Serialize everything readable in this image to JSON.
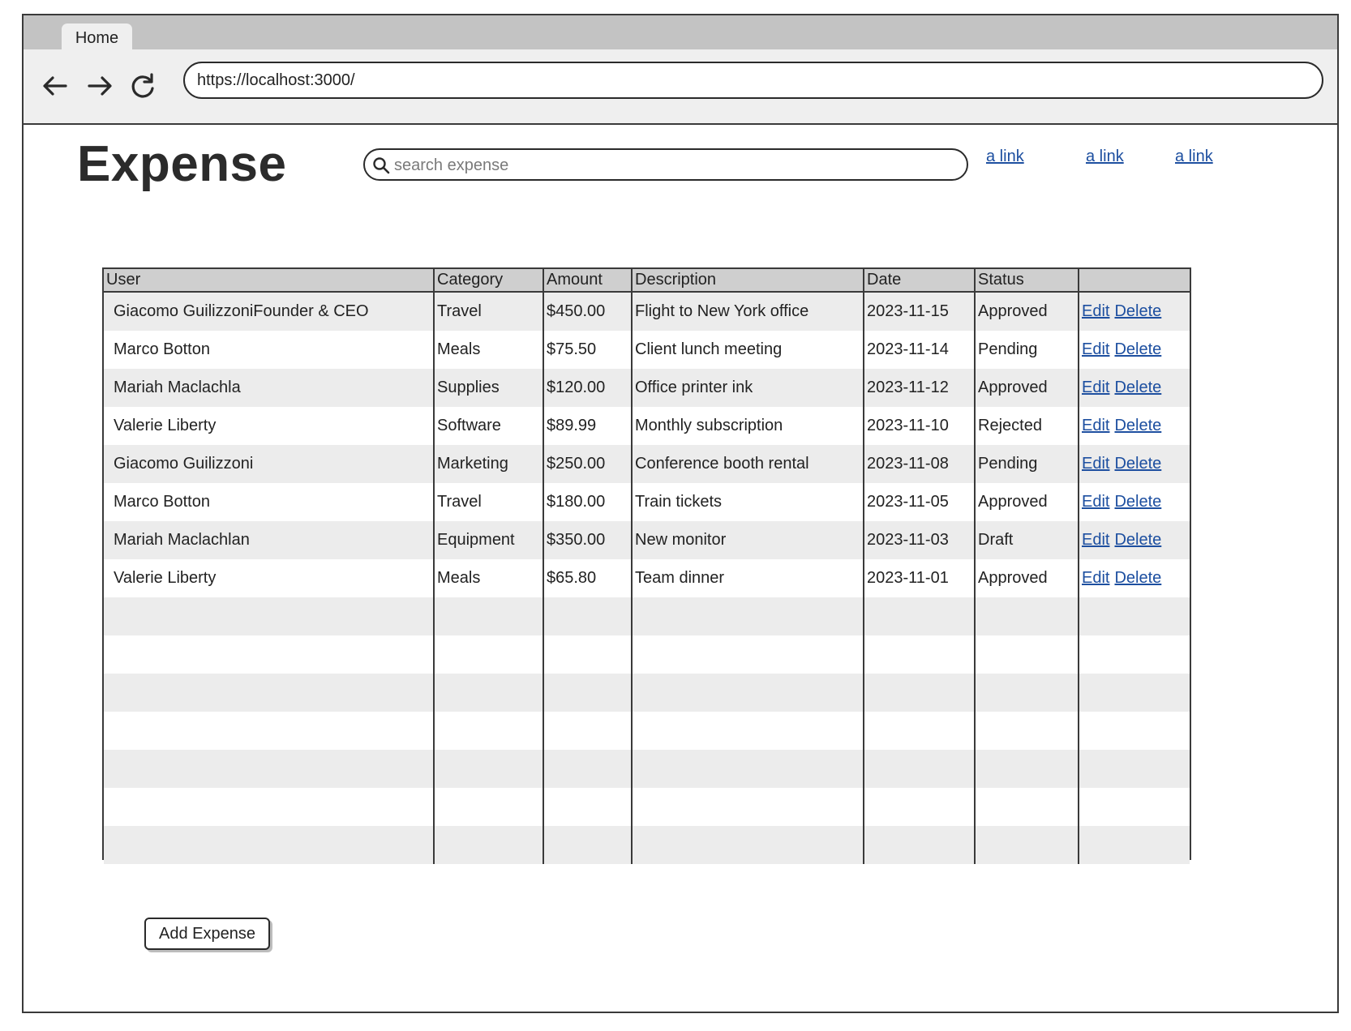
{
  "browser": {
    "tab_label": "Home",
    "url": "https://localhost:3000/"
  },
  "header": {
    "title": "Expense",
    "search_placeholder": "search expense",
    "links": [
      "a link",
      "a link",
      "a link"
    ]
  },
  "table": {
    "columns": [
      "User",
      "Category",
      "Amount",
      "Description",
      "Date",
      "Status",
      ""
    ],
    "rows": [
      {
        "user": "Giacomo GuilizzoniFounder & CEO",
        "category": "Travel",
        "amount": "$450.00",
        "description": "Flight to New York office",
        "date": "2023-11-15",
        "status": "Approved",
        "edit": "Edit",
        "delete": "Delete"
      },
      {
        "user": "Marco Botton",
        "category": "Meals",
        "amount": "$75.50",
        "description": "Client lunch meeting",
        "date": "2023-11-14",
        "status": "Pending",
        "edit": "Edit",
        "delete": "Delete"
      },
      {
        "user": "Mariah Maclachla",
        "category": "Supplies",
        "amount": "$120.00",
        "description": "Office printer ink",
        "date": "2023-11-12",
        "status": "Approved",
        "edit": "Edit",
        "delete": "Delete"
      },
      {
        "user": "Valerie Liberty",
        "category": "Software",
        "amount": "$89.99",
        "description": "Monthly subscription",
        "date": "2023-11-10",
        "status": "Rejected",
        "edit": "Edit",
        "delete": "Delete"
      },
      {
        "user": "Giacomo Guilizzoni",
        "category": "Marketing",
        "amount": "$250.00",
        "description": "Conference booth rental",
        "date": "2023-11-08",
        "status": "Pending",
        "edit": "Edit",
        "delete": "Delete"
      },
      {
        "user": "Marco Botton",
        "category": "Travel",
        "amount": "$180.00",
        "description": "Train tickets",
        "date": "2023-11-05",
        "status": "Approved",
        "edit": "Edit",
        "delete": "Delete"
      },
      {
        "user": "Mariah Maclachlan",
        "category": "Equipment",
        "amount": "$350.00",
        "description": "New monitor",
        "date": "2023-11-03",
        "status": "Draft",
        "edit": "Edit",
        "delete": "Delete"
      },
      {
        "user": "Valerie Liberty",
        "category": "Meals",
        "amount": "$65.80",
        "description": "Team dinner",
        "date": "2023-11-01",
        "status": "Approved",
        "edit": "Edit",
        "delete": "Delete"
      }
    ],
    "empty_rows": 7
  },
  "actions": {
    "add_expense_label": "Add Expense"
  },
  "icons": {
    "back": "arrow-left-icon",
    "forward": "arrow-right-icon",
    "reload": "reload-icon",
    "search": "search-icon"
  },
  "colors": {
    "link": "#1d4fa0",
    "header_row": "#cfcfcf",
    "stripe": "#ececec",
    "tabbar": "#c3c3c3"
  }
}
